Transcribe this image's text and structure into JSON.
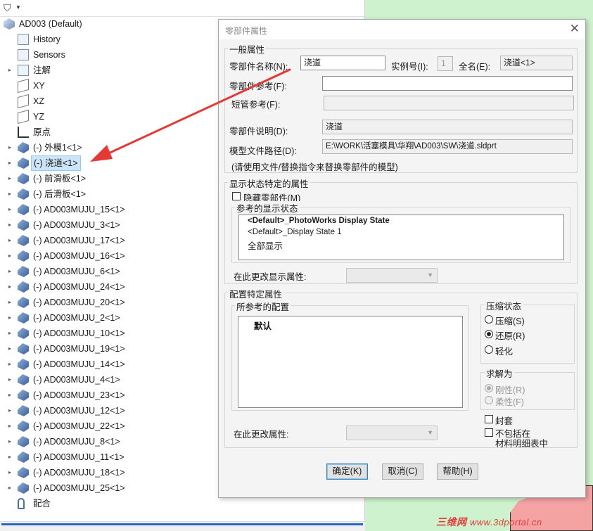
{
  "tree": {
    "root": "AD003  (Default)",
    "items": [
      {
        "label": "History",
        "icon": "history-icon",
        "exp": false
      },
      {
        "label": "Sensors",
        "icon": "sensors-icon",
        "exp": false
      },
      {
        "label": "注解",
        "icon": "annotation-icon",
        "exp": true
      },
      {
        "label": "XY",
        "icon": "plane-icon",
        "exp": false
      },
      {
        "label": "XZ",
        "icon": "plane-icon",
        "exp": false
      },
      {
        "label": "YZ",
        "icon": "plane-icon",
        "exp": false
      },
      {
        "label": "原点",
        "icon": "origin-icon",
        "exp": false
      },
      {
        "label": "(-) 外模1<1>",
        "icon": "part-icon",
        "exp": true
      },
      {
        "label": "(-) 浇道<1>",
        "icon": "part-icon",
        "exp": true,
        "selected": true
      },
      {
        "label": "(-) 前滑板<1>",
        "icon": "part-icon",
        "exp": true
      },
      {
        "label": "(-) 后滑板<1>",
        "icon": "part-icon",
        "exp": true
      },
      {
        "label": "(-) AD003MUJU_15<1>",
        "icon": "part-icon",
        "exp": true
      },
      {
        "label": "(-) AD003MUJU_3<1>",
        "icon": "part-icon",
        "exp": true
      },
      {
        "label": "(-) AD003MUJU_17<1>",
        "icon": "part-icon",
        "exp": true
      },
      {
        "label": "(-) AD003MUJU_16<1>",
        "icon": "part-icon",
        "exp": true
      },
      {
        "label": "(-) AD003MUJU_6<1>",
        "icon": "part-icon",
        "exp": true
      },
      {
        "label": "(-) AD003MUJU_24<1>",
        "icon": "part-icon",
        "exp": true
      },
      {
        "label": "(-) AD003MUJU_20<1>",
        "icon": "part-icon",
        "exp": true
      },
      {
        "label": "(-) AD003MUJU_2<1>",
        "icon": "part-icon",
        "exp": true
      },
      {
        "label": "(-) AD003MUJU_10<1>",
        "icon": "part-icon",
        "exp": true
      },
      {
        "label": "(-) AD003MUJU_19<1>",
        "icon": "part-icon",
        "exp": true
      },
      {
        "label": "(-) AD003MUJU_14<1>",
        "icon": "part-icon",
        "exp": true
      },
      {
        "label": "(-) AD003MUJU_4<1>",
        "icon": "part-icon",
        "exp": true
      },
      {
        "label": "(-) AD003MUJU_23<1>",
        "icon": "part-icon",
        "exp": true
      },
      {
        "label": "(-) AD003MUJU_12<1>",
        "icon": "part-icon",
        "exp": true
      },
      {
        "label": "(-) AD003MUJU_22<1>",
        "icon": "part-icon",
        "exp": true
      },
      {
        "label": "(-) AD003MUJU_8<1>",
        "icon": "part-icon",
        "exp": true
      },
      {
        "label": "(-) AD003MUJU_11<1>",
        "icon": "part-icon",
        "exp": true
      },
      {
        "label": "(-) AD003MUJU_18<1>",
        "icon": "part-icon",
        "exp": true
      },
      {
        "label": "(-) AD003MUJU_25<1>",
        "icon": "part-icon",
        "exp": true
      },
      {
        "label": "配合",
        "icon": "mates-icon",
        "exp": false
      }
    ]
  },
  "dialog": {
    "title": "零部件属性",
    "general": {
      "group": "一般属性",
      "name_label": "零部件名称(N):",
      "name_value": "浇道",
      "instance_label": "实例号(I):",
      "instance_value": "1",
      "fullname_label": "全名(E):",
      "fullname_value": "浇道<1>",
      "ref_label": "零部件参考(F):",
      "ref_value": "",
      "pipe_label": "短管参考(F):",
      "pipe_value": "",
      "desc_label": "零部件说明(D):",
      "desc_value": "浇道",
      "path_label": "模型文件路径(D):",
      "path_value": "E:\\WORK\\活塞模具\\华翔\\AD003\\SW\\浇道.sldprt",
      "note": "(请使用文件/替换指令来替换零部件的模型)"
    },
    "display": {
      "group": "显示状态特定的属性",
      "hide_label": "隐藏零部件(M)",
      "ref_states_label": "参考的显示状态",
      "states": [
        "<Default>_PhotoWorks Display State",
        "<Default>_Display State 1",
        "全部显示"
      ],
      "change_label": "在此更改显示属性:"
    },
    "config": {
      "group": "配置特定属性",
      "ref_config_label": "所参考的配置",
      "configs": [
        "默认"
      ],
      "suppress_group": "压缩状态",
      "suppress_options": [
        "压缩(S)",
        "还原(R)",
        "轻化"
      ],
      "suppress_selected": 1,
      "solve_group": "求解为",
      "solve_options": [
        "刚性(R)",
        "柔性(F)"
      ],
      "solve_selected": 0,
      "envelope_label": "封套",
      "exclude_bom_label_1": "不包括在",
      "exclude_bom_label_2": "材料明细表中",
      "change_label": "在此更改属性:"
    },
    "buttons": {
      "ok": "确定(K)",
      "cancel": "取消(C)",
      "help": "帮助(H)"
    }
  },
  "watermark": {
    "cn": "三维网",
    "url": "www.3dportal.cn"
  },
  "colors": {
    "graphics_bg": "#cdf2cd",
    "arrow": "#e53935",
    "selection": "#cce4f7"
  }
}
